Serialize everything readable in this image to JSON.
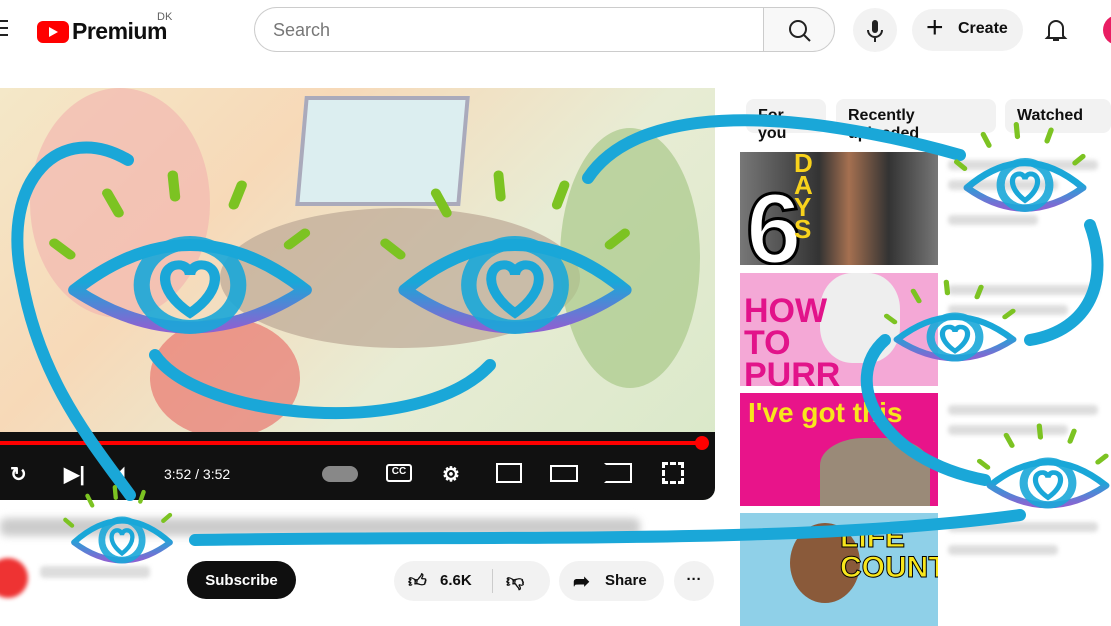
{
  "header": {
    "brand": "Premium",
    "region": "DK",
    "search_placeholder": "Search",
    "create_label": "Create"
  },
  "player": {
    "time": "3:52 / 3:52",
    "progress": 1.0
  },
  "sidebar": {
    "chips": [
      "For you",
      "Recently uploaded",
      "Watched"
    ],
    "thumbnails": [
      {
        "big": "6",
        "side": "DAYS"
      },
      {
        "text": "HOW TO PURR"
      },
      {
        "text": "I've got this"
      },
      {
        "text": "LIFE COUNT"
      }
    ]
  },
  "actions": {
    "subscribe": "Subscribe",
    "likes": "6.6K",
    "share": "Share",
    "more": "···"
  },
  "colors": {
    "eye_blue": "#1aa7d8",
    "eye_purple": "#8a63d2",
    "lash_green": "#7cc322",
    "youtube_red": "#ff0000"
  }
}
